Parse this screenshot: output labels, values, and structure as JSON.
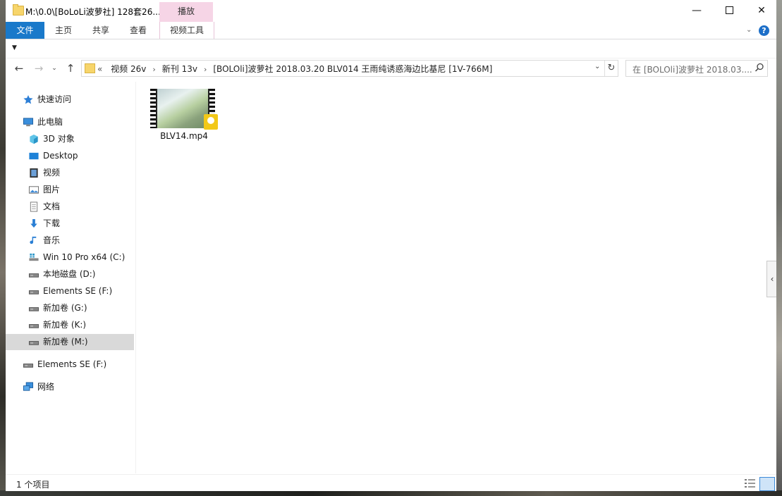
{
  "title_bar": {
    "title": "M:\\0.0\\[BoLoLi波萝社] 128套26...",
    "context_header": "播放"
  },
  "ribbon": {
    "tabs": [
      {
        "label": "文件",
        "active": true
      },
      {
        "label": "主页",
        "active": false
      },
      {
        "label": "共享",
        "active": false
      },
      {
        "label": "查看",
        "active": false
      },
      {
        "label": "视频工具",
        "active": false
      }
    ]
  },
  "address_bar": {
    "crumbs": [
      "视频 26v",
      "新刊 13v",
      "[BOLOli]波萝社 2018.03.20 BLV014 王雨纯诱惑海边比基尼 [1V-766M]"
    ],
    "overflow": "«"
  },
  "search": {
    "placeholder": "在 [BOLOli]波萝社 2018.03...."
  },
  "sidebar": {
    "items": [
      {
        "label": "快速访问",
        "icon": "star-icon"
      },
      {
        "label": "此电脑",
        "icon": "pc-icon"
      },
      {
        "label": "3D 对象",
        "icon": "cube-icon"
      },
      {
        "label": "Desktop",
        "icon": "desktop-icon"
      },
      {
        "label": "视频",
        "icon": "video-icon"
      },
      {
        "label": "图片",
        "icon": "pictures-icon"
      },
      {
        "label": "文档",
        "icon": "documents-icon"
      },
      {
        "label": "下载",
        "icon": "download-icon"
      },
      {
        "label": "音乐",
        "icon": "music-icon"
      },
      {
        "label": "Win 10 Pro x64 (C:)",
        "icon": "system-drive-icon"
      },
      {
        "label": "本地磁盘 (D:)",
        "icon": "drive-icon"
      },
      {
        "label": "Elements SE (F:)",
        "icon": "drive-icon"
      },
      {
        "label": "新加卷 (G:)",
        "icon": "drive-icon"
      },
      {
        "label": "新加卷 (K:)",
        "icon": "drive-icon"
      },
      {
        "label": "新加卷 (M:)",
        "icon": "drive-icon",
        "selected": true
      },
      {
        "label": "Elements SE (F:)",
        "icon": "drive-icon"
      },
      {
        "label": "网络",
        "icon": "network-icon"
      }
    ]
  },
  "content": {
    "files": [
      {
        "name": "BLV14.mp4",
        "badge": "Player"
      }
    ]
  },
  "status_bar": {
    "item_count": "1 个项目"
  },
  "colors": {
    "accent": "#1979ca",
    "context_tab": "#f6d5e6",
    "selected_bg": "#d9d9d9"
  }
}
